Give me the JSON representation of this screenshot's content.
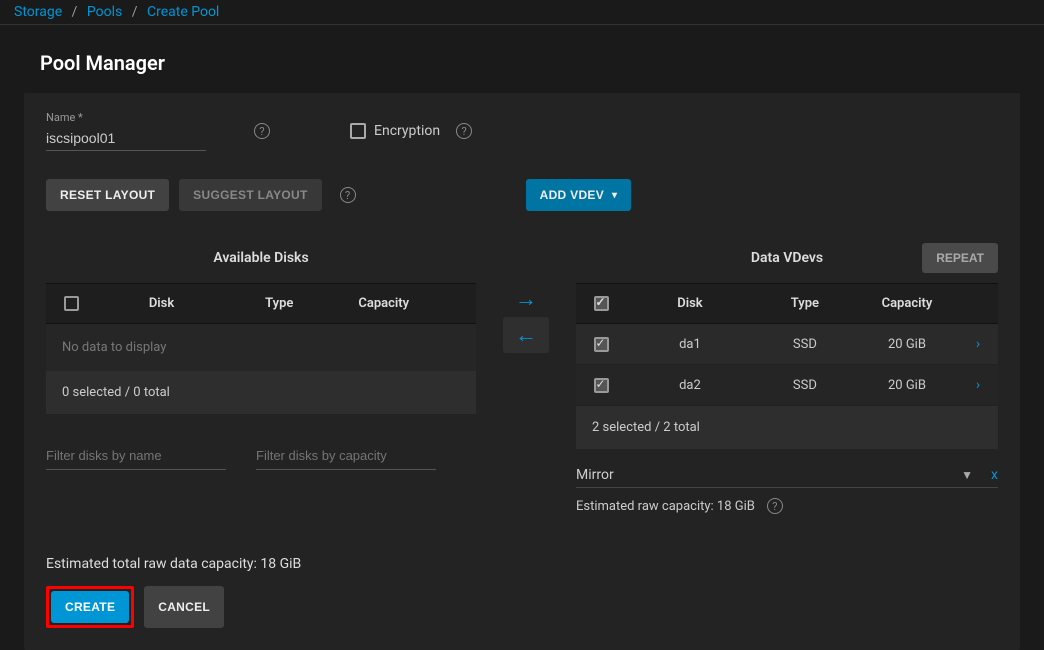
{
  "breadcrumb": {
    "storage": "Storage",
    "pools": "Pools",
    "create": "Create Pool"
  },
  "title": "Pool Manager",
  "name_field": {
    "label": "Name *",
    "value": "iscsipool01"
  },
  "encryption_label": "Encryption",
  "buttons": {
    "reset": "RESET LAYOUT",
    "suggest": "SUGGEST LAYOUT",
    "add_vdev": "ADD VDEV",
    "repeat": "REPEAT",
    "create": "CREATE",
    "cancel": "CANCEL"
  },
  "available": {
    "title": "Available Disks",
    "headers": {
      "disk": "Disk",
      "type": "Type",
      "capacity": "Capacity"
    },
    "empty": "No data to display",
    "selection": "0 selected / 0 total",
    "filter_name_ph": "Filter disks by name",
    "filter_cap_ph": "Filter disks by capacity"
  },
  "vdevs": {
    "title": "Data VDevs",
    "headers": {
      "disk": "Disk",
      "type": "Type",
      "capacity": "Capacity"
    },
    "rows": [
      {
        "disk": "da1",
        "type": "SSD",
        "capacity": "20 GiB"
      },
      {
        "disk": "da2",
        "type": "SSD",
        "capacity": "20 GiB"
      }
    ],
    "selection": "2 selected / 2 total",
    "layout": "Mirror",
    "est_cap": "Estimated raw capacity: 18 GiB",
    "remove": "x"
  },
  "total_cap": "Estimated total raw data capacity: 18 GiB"
}
